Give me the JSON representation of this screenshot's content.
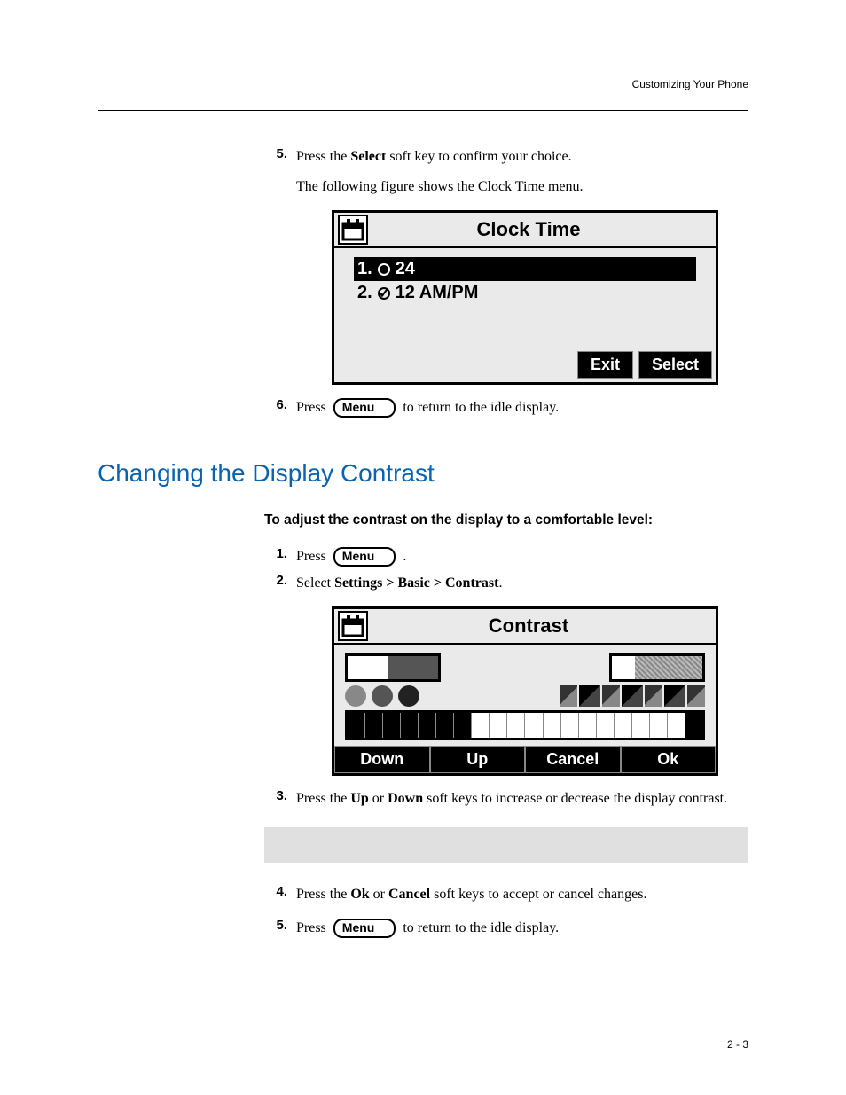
{
  "running_head": "Customizing Your Phone",
  "page_number": "2 - 3",
  "section_heading": "Changing the Display Contrast",
  "lead_in": "To adjust the contrast on the display to a comfortable level:",
  "menu_key_label": "Menu",
  "steps_a": {
    "s5": {
      "num": "5.",
      "pre": "Press the ",
      "bold": "Select",
      "post": " soft key to confirm your choice."
    },
    "s5_para": "The following figure shows the Clock Time menu.",
    "s6": {
      "num": "6.",
      "pre": "Press ",
      "post": " to return to the idle display."
    }
  },
  "steps_b": {
    "s1": {
      "num": "1.",
      "pre": "Press ",
      "post": " ."
    },
    "s2": {
      "num": "2.",
      "pre": "Select ",
      "bold": "Settings > Basic > Contrast",
      "post": "."
    },
    "s3": {
      "num": "3.",
      "pre": "Press the ",
      "bold1": "Up",
      "mid": " or ",
      "bold2": "Down",
      "post": " soft keys to increase or decrease the display contrast."
    },
    "s4": {
      "num": "4.",
      "pre": "Press the ",
      "bold1": "Ok",
      "mid": " or ",
      "bold2": "Cancel",
      "post": " soft keys to accept or cancel changes."
    },
    "s5": {
      "num": "5.",
      "pre": "Press ",
      "post": " to return to the idle display."
    }
  },
  "fig_clock": {
    "title": "Clock Time",
    "opt1_num": "1.",
    "opt1_label": "24",
    "opt2_num": "2.",
    "opt2_label": "12 AM/PM",
    "sk_exit": "Exit",
    "sk_select": "Select"
  },
  "fig_contrast": {
    "title": "Contrast",
    "sk_down": "Down",
    "sk_up": "Up",
    "sk_cancel": "Cancel",
    "sk_ok": "Ok"
  }
}
